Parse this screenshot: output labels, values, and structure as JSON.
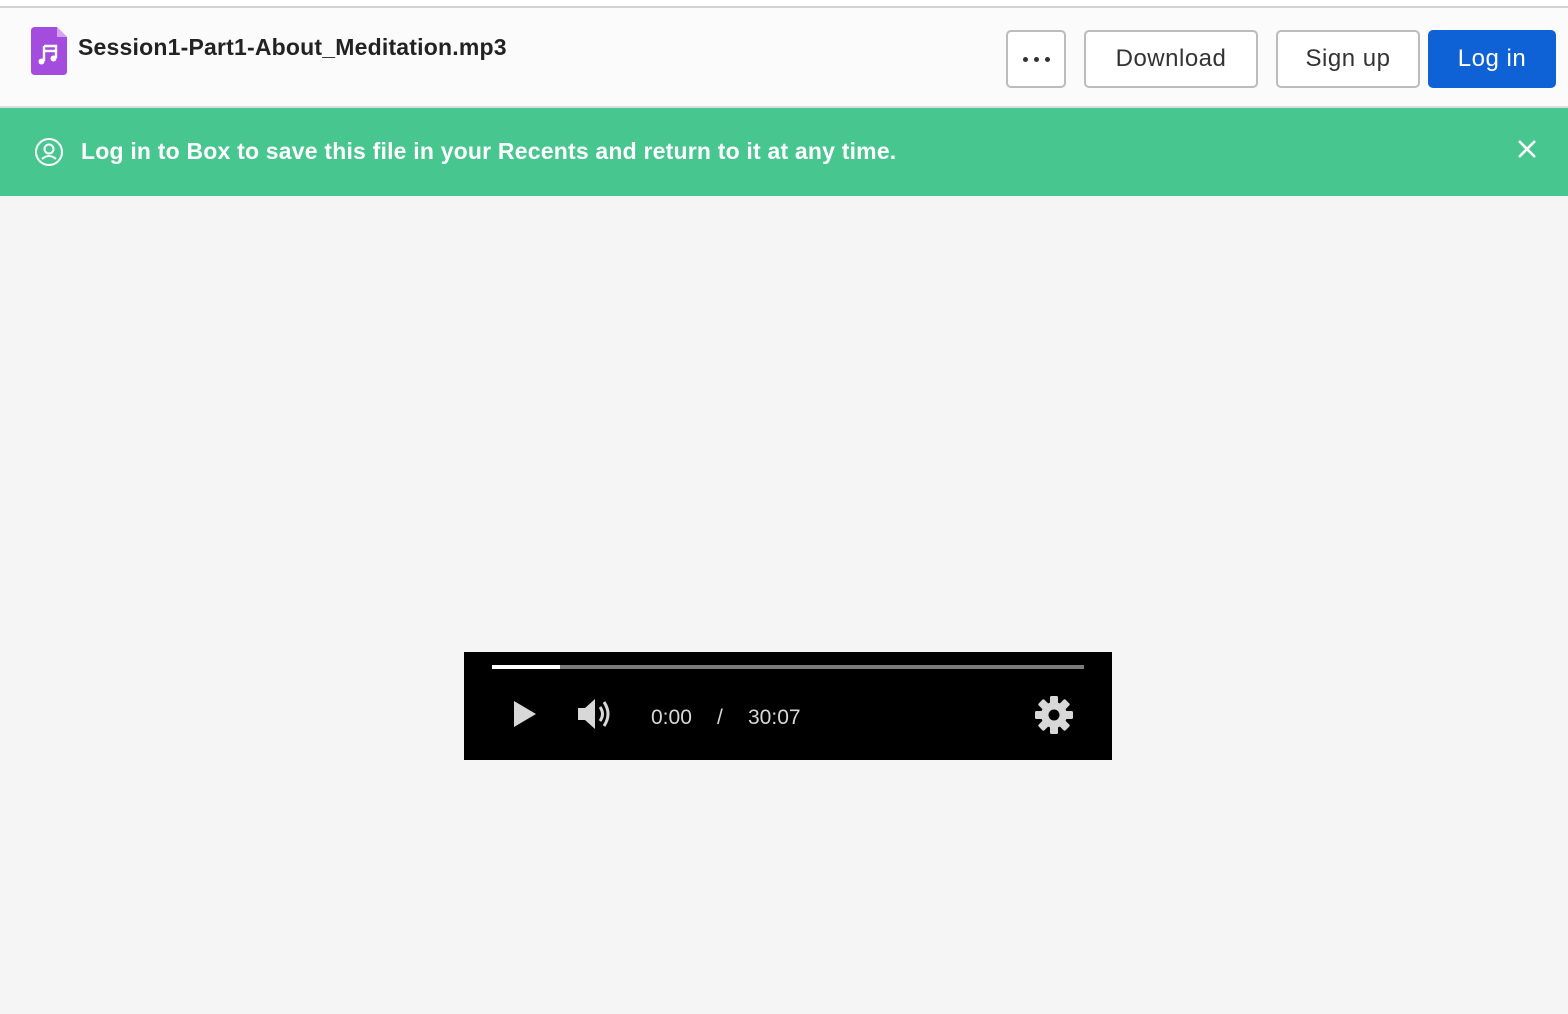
{
  "header": {
    "file_name": "Session1-Part1-About_Meditation.mp3",
    "file_icon": "audio-file-icon",
    "more_icon": "more-options-icon",
    "download_label": "Download",
    "signup_label": "Sign up",
    "login_label": "Log in"
  },
  "banner": {
    "icon": "user-circle-icon",
    "text": "Log in to Box to save this file in your Recents and return to it at any time.",
    "close_icon": "close-icon"
  },
  "player": {
    "current_time": "0:00",
    "separator": "/",
    "total_time": "30:07",
    "buffered_fraction": 0.115,
    "icons": {
      "play": "play-icon",
      "volume": "volume-icon",
      "settings": "gear-icon"
    }
  },
  "colors": {
    "accent": "#0f62d6",
    "banner": "#47c78f",
    "file_icon": "#a44cde",
    "player_bg": "#000000"
  }
}
